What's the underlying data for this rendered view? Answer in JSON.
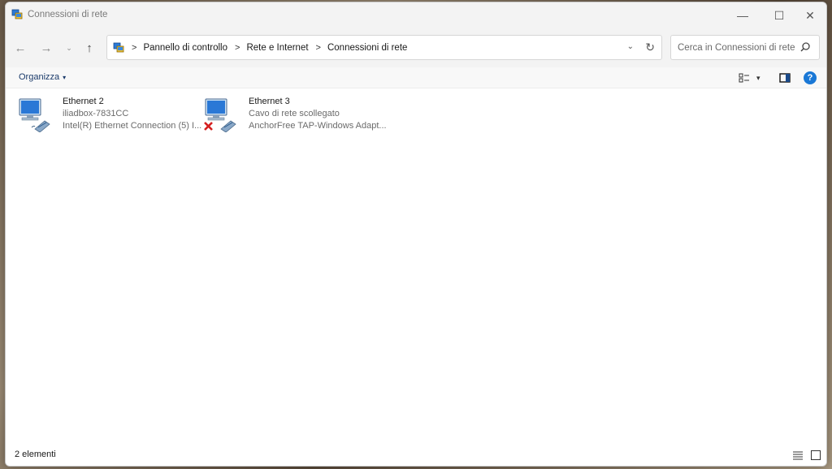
{
  "window": {
    "title": "Connessioni di rete",
    "controls": {
      "minimize": "—",
      "maximize": "☐",
      "close": "✕"
    }
  },
  "nav": {
    "back": "←",
    "forward": "→",
    "recent": "⌄",
    "up": "↑",
    "breadcrumbs": [
      "Pannello di controllo",
      "Rete e Internet",
      "Connessioni di rete"
    ],
    "crumb_separator": ">",
    "dropdown": "⌄",
    "refresh": "↻",
    "search_placeholder": "Cerca in Connessioni di rete"
  },
  "toolbar": {
    "organize_label": "Organizza",
    "organize_caret": "▾",
    "view_caret": "▾",
    "help": "?"
  },
  "connections": [
    {
      "name": "Ethernet 2",
      "status": "iliadbox-7831CC",
      "device": "Intel(R) Ethernet Connection (5) I...",
      "disconnected": false
    },
    {
      "name": "Ethernet 3",
      "status": "Cavo di rete scollegato",
      "device": "AnchorFree TAP-Windows Adapt...",
      "disconnected": true
    }
  ],
  "statusbar": {
    "item_count": "2 elementi"
  },
  "colors": {
    "accent": "#1a78d6",
    "error": "#d41f1f"
  }
}
